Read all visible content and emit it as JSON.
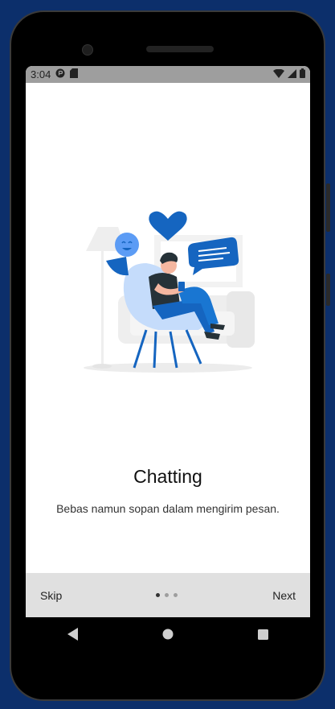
{
  "status_bar": {
    "time": "3:04"
  },
  "onboarding": {
    "title": "Chatting",
    "subtitle": "Bebas namun sopan dalam mengirim pesan.",
    "page_count": 3,
    "active_page": 1
  },
  "bottom_bar": {
    "skip_label": "Skip",
    "next_label": "Next"
  },
  "colors": {
    "accent": "#1565c0",
    "accent_light": "#5c9cf5",
    "bar_bg": "#e0e0e0",
    "frame_bg": "#0c2f6b"
  },
  "icons": [
    "signal-icon",
    "wifi-icon",
    "battery-icon",
    "back-icon",
    "home-icon",
    "recents-icon"
  ]
}
